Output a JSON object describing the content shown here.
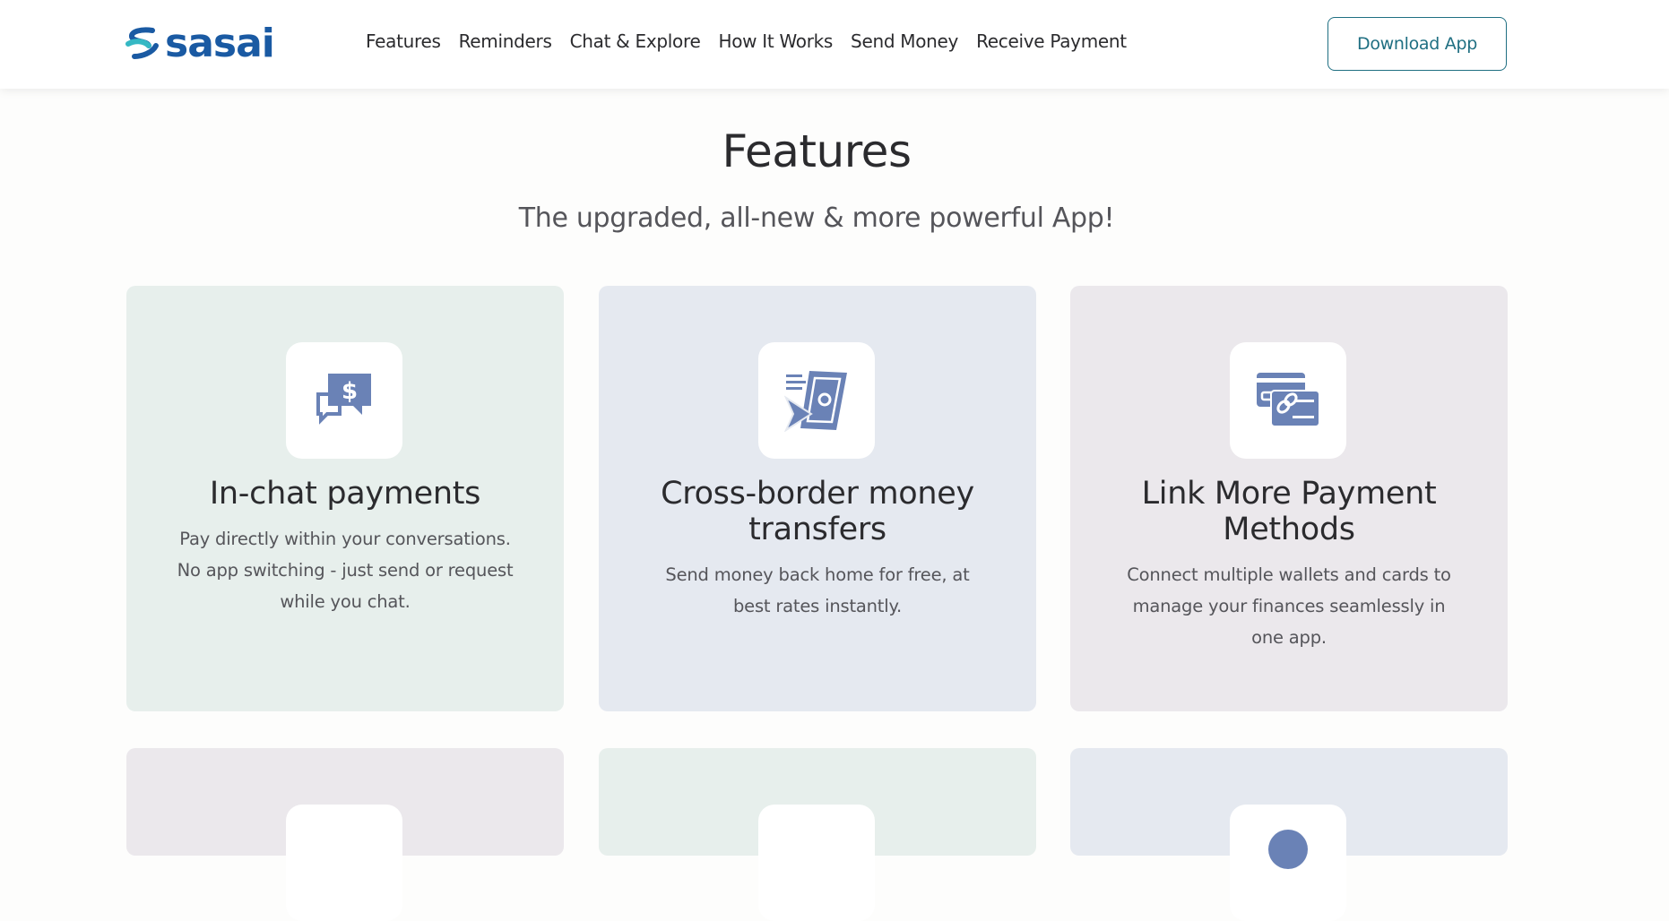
{
  "header": {
    "logo_text": "sasai",
    "brand_color": "#1a5aa3",
    "accent_color": "#35b8c4",
    "nav": [
      {
        "label": "Features"
      },
      {
        "label": "Reminders"
      },
      {
        "label": "Chat & Explore"
      },
      {
        "label": "How It Works"
      },
      {
        "label": "Send Money"
      },
      {
        "label": "Receive Payment"
      }
    ],
    "download_label": "Download App"
  },
  "section": {
    "title": "Features",
    "subtitle": "The upgraded, all-new & more powerful App!"
  },
  "cards": [
    {
      "icon": "chat-dollar-icon",
      "title": "In-chat payments",
      "description": "Pay directly within your conversations. No app switching - just send or request while you chat.",
      "bg": "#e7efec"
    },
    {
      "icon": "money-transfer-icon",
      "title": "Cross-border money transfers",
      "description": "Send money back home for free, at best rates instantly.",
      "bg": "#e5e9f0"
    },
    {
      "icon": "linked-cards-icon",
      "title": "Link More Payment Methods",
      "description": "Connect multiple wallets and cards to manage your finances seamlessly in one app.",
      "bg": "#ebe8ec"
    }
  ],
  "next_row_colors": [
    "#ebe8ec",
    "#e7efec",
    "#e5e9f0"
  ],
  "icon_color": "#6a82b6"
}
